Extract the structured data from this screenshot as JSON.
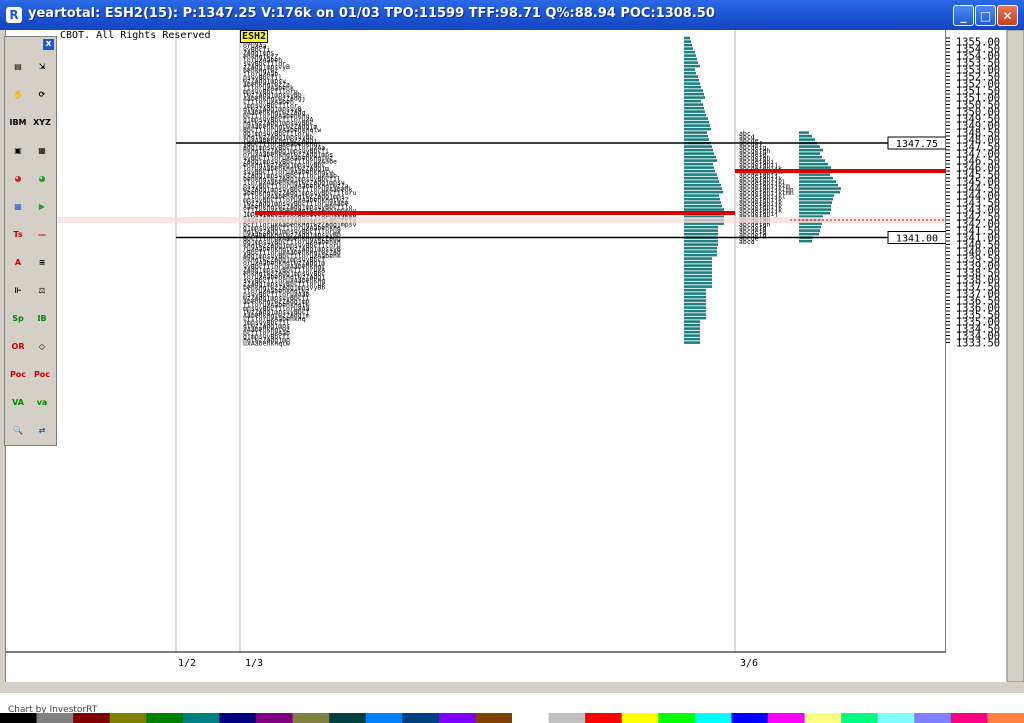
{
  "window": {
    "title": "yeartotal: ESH2(15): P:1347.25 V:176k on 01/03 TPO:11599 TFF:98.71 Q%:88.94 POC:1308.50",
    "icon": "R"
  },
  "chart": {
    "copyright": "CBOT. All Rights Reserved",
    "symbol_tag": "ESH2",
    "period_labels": [
      "1/2",
      "1/3",
      "3/6"
    ],
    "footer": "Chart by InvestorRT",
    "price_levels": {
      "top": 1355.25,
      "step": 0.25,
      "label_every": 0.5
    },
    "current_price": "1347.25",
    "level_lines": [
      {
        "price": 1347.75,
        "label": "1347.75"
      },
      {
        "price": 1341.0,
        "label": "1341.00"
      }
    ],
    "red_lines": [
      1345.75,
      1342.75
    ],
    "highlight_price": "1342.25",
    "colors": {
      "bar": "#1f7f7f",
      "red_line": "#dd0000",
      "current_price": "#dd0000"
    }
  },
  "palette": {
    "close_label": "x",
    "tools": [
      "select",
      "pointer",
      "hand",
      "refresh",
      "ibm",
      "xyz",
      "camera",
      "document",
      "pie-chart",
      "pie-chart-2",
      "grid",
      "play",
      "ts",
      "line",
      "A",
      "lines",
      "fibonacci",
      "scale",
      "Sp",
      "IB",
      "OR",
      "diamond",
      "Poc",
      "Poc cv",
      "VA",
      "va vo",
      "magnifier",
      "arrows"
    ]
  }
}
